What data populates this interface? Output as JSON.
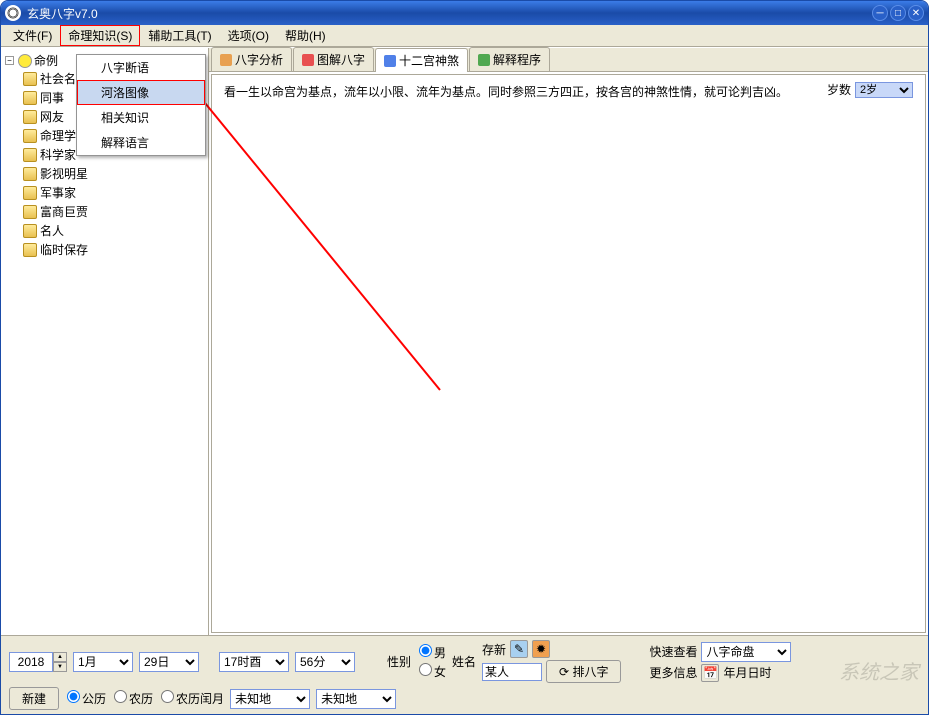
{
  "window": {
    "title": "玄奥八字v7.0"
  },
  "menubar": {
    "items": [
      {
        "label": "文件(F)"
      },
      {
        "label": "命理知识(S)"
      },
      {
        "label": "辅助工具(T)"
      },
      {
        "label": "选项(O)"
      },
      {
        "label": "帮助(H)"
      }
    ]
  },
  "dropdown": {
    "items": [
      {
        "label": "八字断语"
      },
      {
        "label": "河洛图像"
      },
      {
        "label": "相关知识"
      },
      {
        "label": "解释语言"
      }
    ]
  },
  "tree": {
    "root": "命例",
    "items": [
      "社会名流",
      "同事",
      "网友",
      "命理学者",
      "科学家",
      "影视明星",
      "军事家",
      "富商巨贾",
      "名人",
      "临时保存"
    ]
  },
  "tabs": {
    "items": [
      {
        "label": "八字分析"
      },
      {
        "label": "图解八字"
      },
      {
        "label": "十二宫神煞"
      },
      {
        "label": "解释程序"
      }
    ],
    "active": 2
  },
  "content": {
    "text": "看一生以命宫为基点，流年以小限、流年为基点。同时参照三方四正，按各宫的神煞性情，就可论判吉凶。",
    "age_label": "岁数",
    "age_value": "2岁"
  },
  "bottom": {
    "year": "2018",
    "month": "1月",
    "day": "29日",
    "hour": "17时酉",
    "minute": "56分",
    "new_btn": "新建",
    "cal_solar": "公历",
    "cal_lunar": "农历",
    "cal_leap": "农历闰月",
    "place1": "未知地",
    "place2": "未知地",
    "gender_label": "性别",
    "gender_male": "男",
    "gender_female": "女",
    "name_label": "姓名",
    "name_value": "某人",
    "save_label": "存新",
    "paiba_btn": "排八字",
    "quick_label": "快速查看",
    "quick_value": "八字命盘",
    "more_label": "更多信息",
    "more_value": "年月日时"
  },
  "watermark": "系统之家"
}
